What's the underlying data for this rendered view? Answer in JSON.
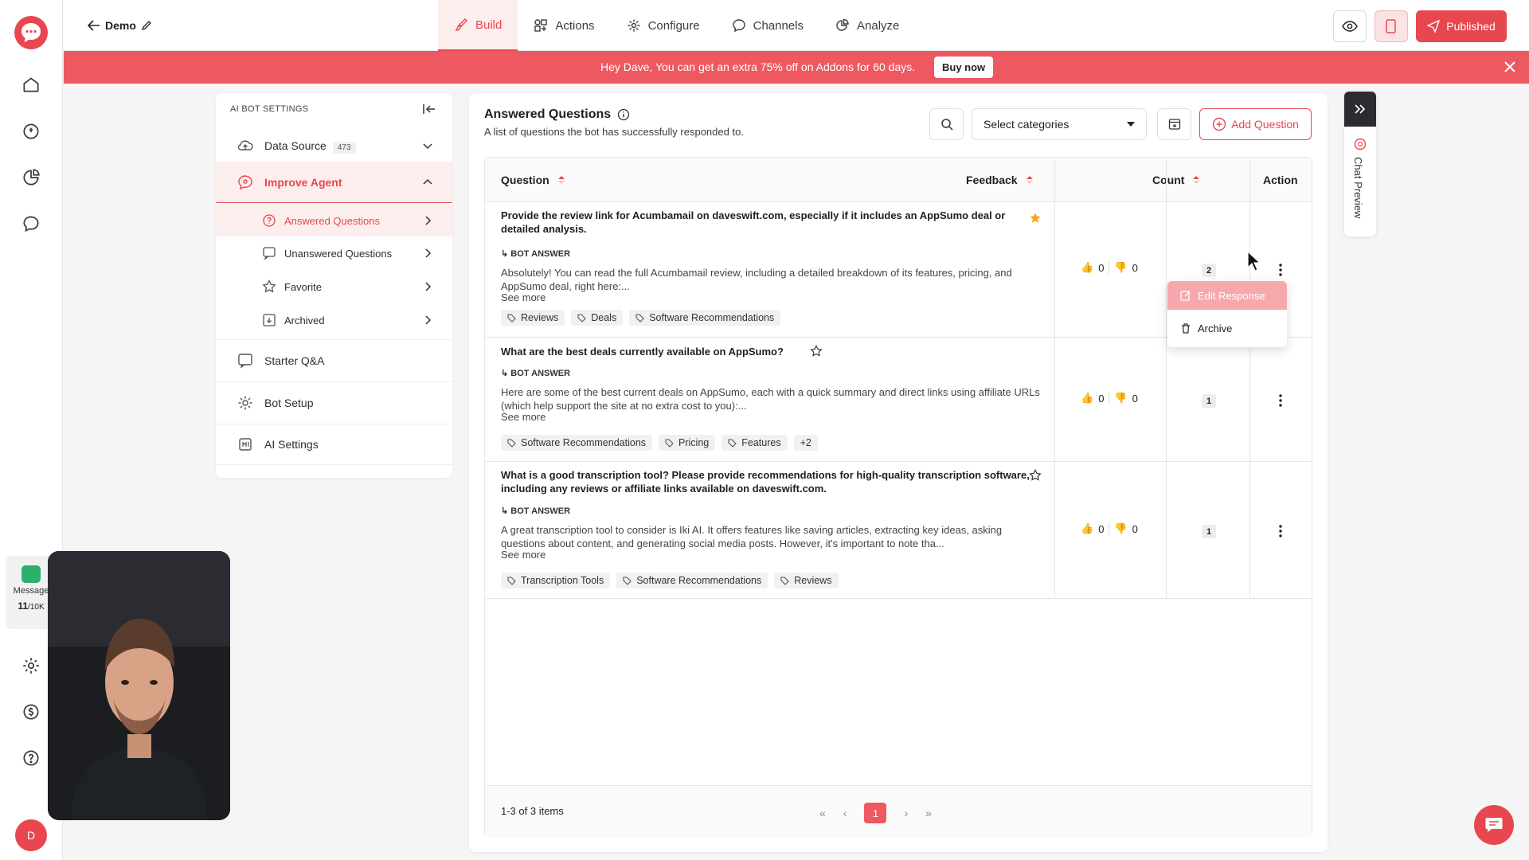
{
  "header": {
    "back_label": "Demo",
    "tabs": [
      {
        "label": "Build",
        "icon": "brush-icon",
        "active": true
      },
      {
        "label": "Actions",
        "icon": "actions-icon",
        "active": false
      },
      {
        "label": "Configure",
        "icon": "gear-icon",
        "active": false
      },
      {
        "label": "Channels",
        "icon": "channels-icon",
        "active": false
      },
      {
        "label": "Analyze",
        "icon": "pie-chart-icon",
        "active": false
      }
    ],
    "publish_label": "Published"
  },
  "banner": {
    "text": "Hey Dave, You can get an extra 75% off on Addons for 60 days.",
    "button": "Buy now"
  },
  "rail": {
    "message_widget": {
      "label": "Message",
      "count": "11",
      "limit": "/10K"
    },
    "user_initial": "D"
  },
  "settings": {
    "heading": "AI BOT SETTINGS",
    "data_source": {
      "label": "Data Source",
      "count": "473"
    },
    "improve_agent": "Improve Agent",
    "submenu": [
      "Answered Questions",
      "Unanswered Questions",
      "Favorite",
      "Archived"
    ],
    "items": [
      "Starter Q&A",
      "Bot Setup",
      "AI Settings"
    ]
  },
  "main": {
    "title": "Answered Questions",
    "subtitle": "A list of questions the bot has successfully responded to.",
    "select_placeholder": "Select categories",
    "add_button": "Add Question",
    "columns": [
      "Question",
      "Feedback",
      "Count",
      "Action"
    ],
    "bot_answer_label": "BOT ANSWER",
    "see_more": "See more",
    "rows": [
      {
        "question": "Provide the review link for Acumbamail on daveswift.com, especially if it includes an AppSumo deal or detailed analysis.",
        "answer": "Absolutely! You can read the full Acumbamail review, including a detailed breakdown of its features, pricing, and AppSumo deal, right here:...",
        "tags": [
          "Reviews",
          "Deals",
          "Software Recommendations"
        ],
        "likes": "0",
        "dislikes": "0",
        "count": "2",
        "starred": true
      },
      {
        "question": "What are the best deals currently available on AppSumo?",
        "answer": "Here are some of the best current deals on AppSumo, each with a quick summary and direct links using affiliate URLs (which help support the site at no extra cost to you):...",
        "tags": [
          "Software Recommendations",
          "Pricing",
          "Features",
          "+2"
        ],
        "likes": "0",
        "dislikes": "0",
        "count": "1",
        "starred": false
      },
      {
        "question": "What is a good transcription tool? Please provide recommendations for high-quality transcription software, including any reviews or affiliate links available on daveswift.com.",
        "answer": "A great transcription tool to consider is Iki AI. It offers features like saving articles, extracting key ideas, asking questions about content, and generating social media posts. However, it's important to note tha...",
        "tags": [
          "Transcription Tools",
          "Software Recommendations",
          "Reviews"
        ],
        "likes": "0",
        "dislikes": "0",
        "count": "1",
        "starred": false
      }
    ],
    "menu": [
      "Edit Response",
      "Archive"
    ],
    "footer_info": "1-3 of 3 items",
    "current_page": "1"
  },
  "chat_preview": "Chat Preview",
  "colors": {
    "accent": "#e8474f",
    "banner": "#ee5961",
    "star": "#f5a623"
  }
}
